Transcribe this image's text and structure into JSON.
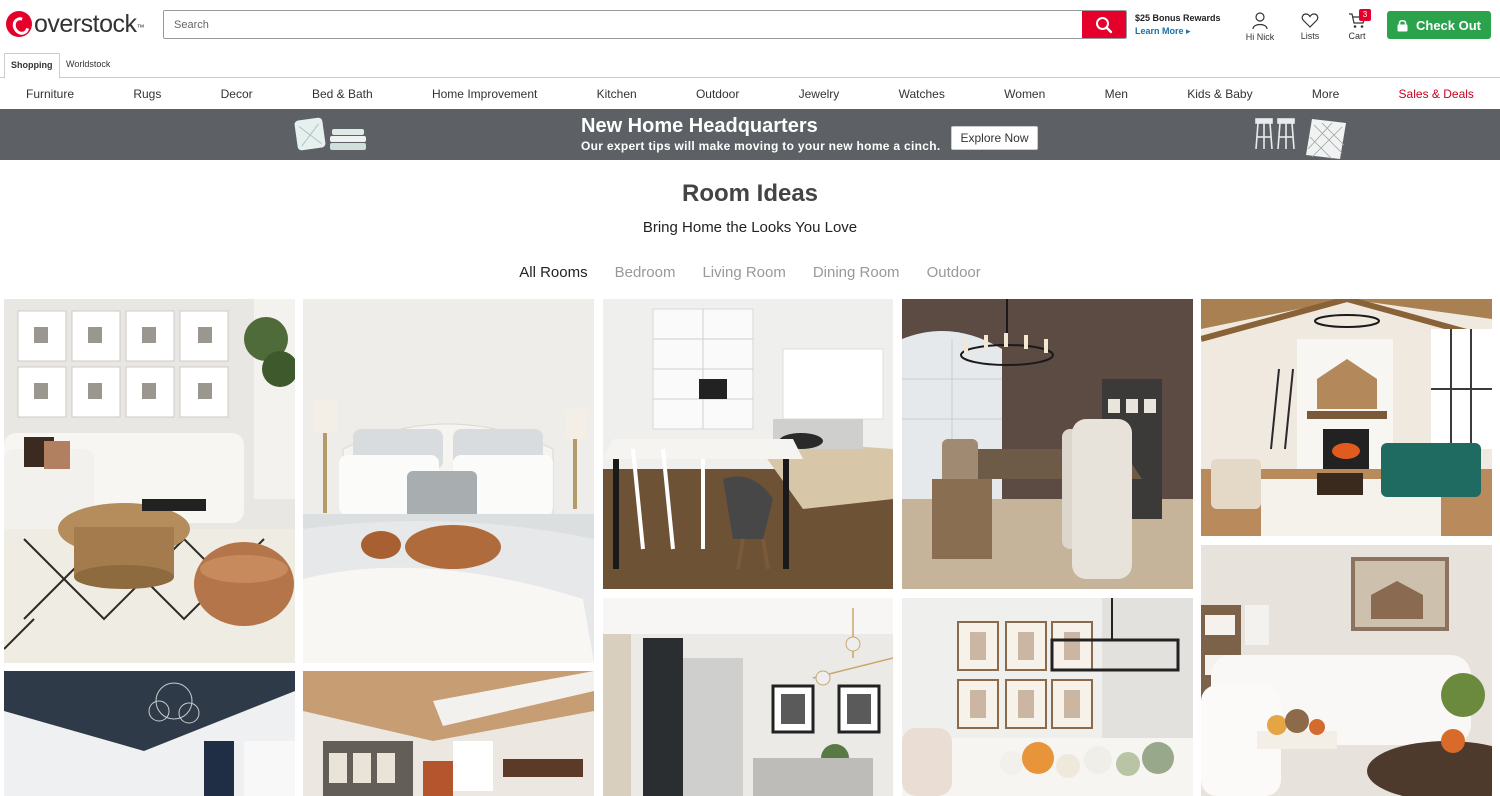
{
  "header": {
    "logo_text": "overstock",
    "search_placeholder": "Search",
    "bonus_title": "$25 Bonus Rewards",
    "bonus_link": "Learn More ▸",
    "account_label": "Hi Nick",
    "lists_label": "Lists",
    "cart_label": "Cart",
    "cart_count": "3",
    "checkout_label": "Check Out"
  },
  "subtabs": [
    "Shopping",
    "Worldstock"
  ],
  "nav": [
    "Furniture",
    "Rugs",
    "Decor",
    "Bed & Bath",
    "Home Improvement",
    "Kitchen",
    "Outdoor",
    "Jewelry",
    "Watches",
    "Women",
    "Men",
    "Kids & Baby",
    "More",
    "Sales & Deals"
  ],
  "banner": {
    "title": "New Home Headquarters",
    "subtitle": "Our expert tips will make moving to your new home a cinch.",
    "button": "Explore Now"
  },
  "page": {
    "title": "Room Ideas",
    "subtitle": "Bring Home the Looks You Love"
  },
  "filters": [
    "All Rooms",
    "Bedroom",
    "Living Room",
    "Dining Room",
    "Outdoor"
  ],
  "colors": {
    "brand_red": "#e4002b",
    "checkout_green": "#2ba24c",
    "banner_bg": "#5d6166",
    "link_blue": "#1a73a8"
  },
  "icons": [
    "search-icon",
    "user-icon",
    "heart-icon",
    "cart-icon",
    "lock-icon"
  ]
}
